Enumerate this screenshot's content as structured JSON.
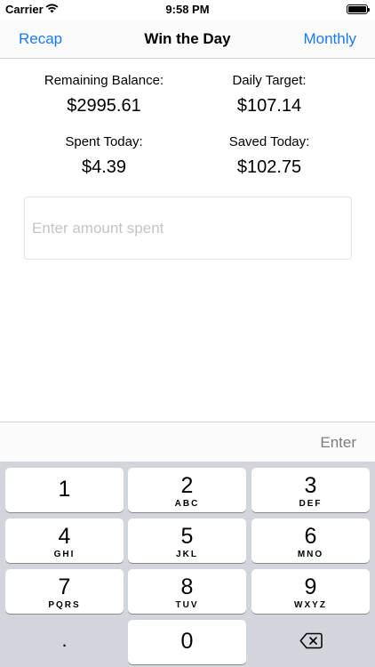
{
  "status_bar": {
    "carrier": "Carrier",
    "time": "9:58 PM",
    "wifi_icon": "wifi-icon",
    "battery_icon": "battery-icon"
  },
  "nav": {
    "left": "Recap",
    "title": "Win the Day",
    "right": "Monthly",
    "accent_color": "#1a7af5"
  },
  "stats": {
    "remaining_balance": {
      "label": "Remaining Balance:",
      "value": "$2995.61"
    },
    "daily_target": {
      "label": "Daily Target:",
      "value": "$107.14"
    },
    "spent_today": {
      "label": "Spent Today:",
      "value": "$4.39"
    },
    "saved_today": {
      "label": "Saved Today:",
      "value": "$102.75"
    }
  },
  "amount_input": {
    "placeholder": "Enter amount spent",
    "value": ""
  },
  "accessory": {
    "enter_label": "Enter"
  },
  "keypad": {
    "keys": [
      {
        "digit": "1",
        "letters": ""
      },
      {
        "digit": "2",
        "letters": "ABC"
      },
      {
        "digit": "3",
        "letters": "DEF"
      },
      {
        "digit": "4",
        "letters": "GHI"
      },
      {
        "digit": "5",
        "letters": "JKL"
      },
      {
        "digit": "6",
        "letters": "MNO"
      },
      {
        "digit": "7",
        "letters": "PQRS"
      },
      {
        "digit": "8",
        "letters": "TUV"
      },
      {
        "digit": "9",
        "letters": "WXYZ"
      },
      {
        "digit": ".",
        "letters": ""
      },
      {
        "digit": "0",
        "letters": ""
      }
    ],
    "backspace_icon": "backspace-icon"
  }
}
